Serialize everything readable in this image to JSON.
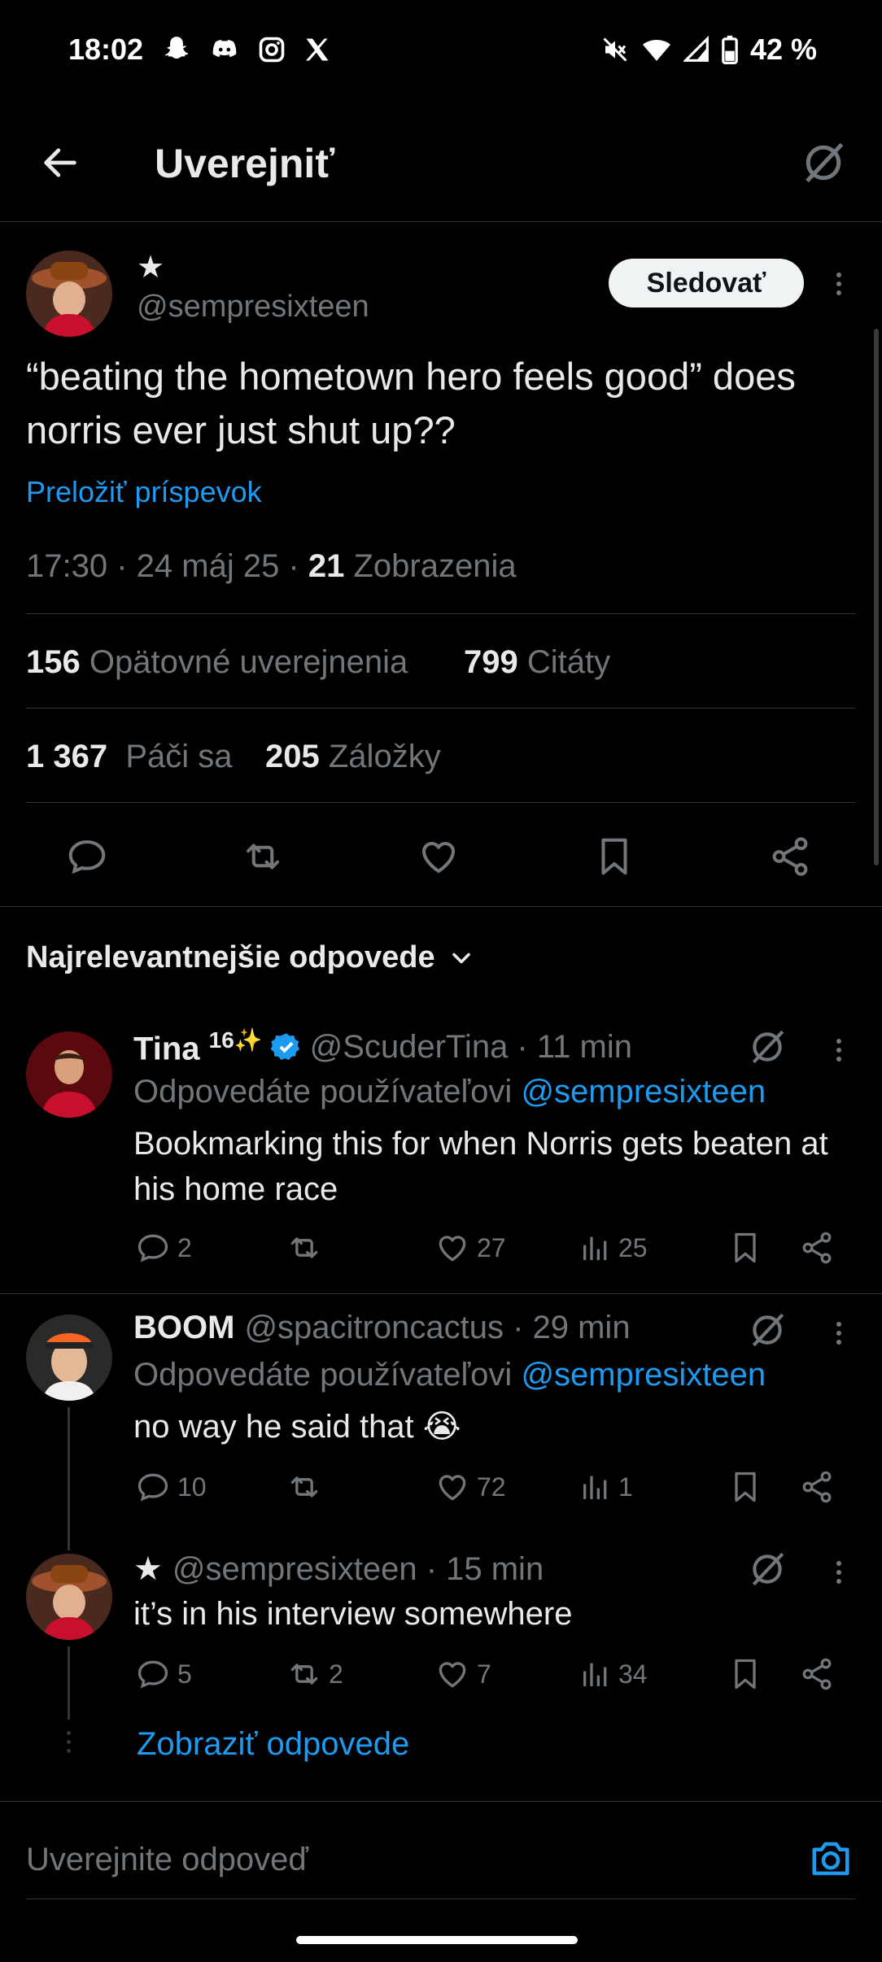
{
  "status_bar": {
    "time": "18:02",
    "battery": "42 %"
  },
  "header": {
    "title": "Uverejniť"
  },
  "post": {
    "name": "★",
    "handle": "@sempresixteen",
    "follow_label": "Sledovať",
    "text": "“beating the hometown hero feels good” does norris ever just shut up??",
    "translate": "Preložiť príspevok",
    "meta_time": "17:30 · 24 máj 25 · ",
    "views_count": "21",
    "views_label": " Zobrazenia",
    "reposts_count": "156",
    "reposts_label": "Opätovné uverejnenia",
    "quotes_count": "799",
    "quotes_label": "Citáty",
    "likes_count": "1 367",
    "likes_label": "Páči sa",
    "bookmarks_count": "205",
    "bookmarks_label": "Záložky"
  },
  "replies_filter": "Najrelevantnejšie odpovede",
  "replies": [
    {
      "name": "Tina ",
      "name_suffix": "16✨",
      "handle": "@ScuderTina · 11 min",
      "replying_prefix": "Odpovedáte používateľovi ",
      "replying_to": "@sempresixteen",
      "text": "Bookmarking this for when Norris gets beaten at his home race",
      "comments": "2",
      "reposts": "",
      "likes": "27",
      "views": "25"
    },
    {
      "name": "BOOM",
      "handle": "@spacitroncactus · 29 min",
      "replying_prefix": "Odpovedáte používateľovi ",
      "replying_to": "@sempresixteen",
      "text": "no way he said that 😭",
      "comments": "10",
      "reposts": "",
      "likes": "72",
      "views": "1"
    },
    {
      "name": "★",
      "handle": "@sempresixteen · 15 min",
      "text": "it’s in his interview somewhere",
      "comments": "5",
      "reposts": "2",
      "likes": "7",
      "views": "34"
    }
  ],
  "show_replies": "Zobraziť odpovede",
  "compose": {
    "placeholder": "Uverejnite odpoveď"
  },
  "colors": {
    "accent": "#1d9bf0",
    "background": "#000000",
    "muted": "#71767b"
  }
}
